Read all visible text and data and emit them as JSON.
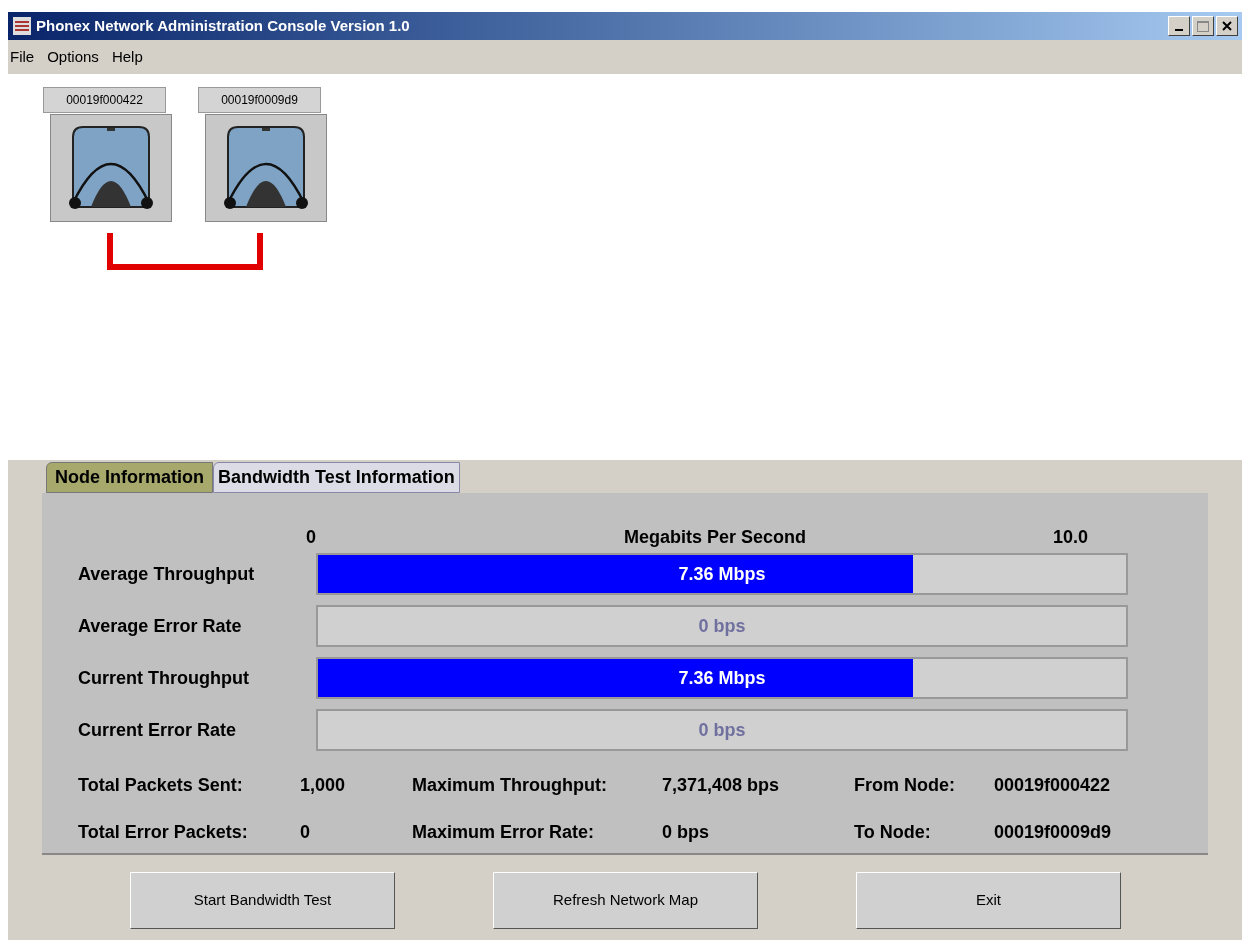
{
  "window": {
    "title": "Phonex Network Administration Console Version 1.0"
  },
  "menu": [
    "File",
    "Options",
    "Help"
  ],
  "nodes": [
    {
      "label": "00019f000422"
    },
    {
      "label": "00019f0009d9"
    }
  ],
  "tabs": [
    {
      "label": "Node Information",
      "selected": true
    },
    {
      "label": "Bandwidth Test Information",
      "selected": false
    }
  ],
  "scale": {
    "min": "0",
    "title": "Megabits Per Second",
    "max": "10.0"
  },
  "meters": [
    {
      "label": "Average Throughput",
      "level": 0.736,
      "reading": "7.36 Mbps"
    },
    {
      "label": "Average Error Rate",
      "level": 0,
      "reading": "0 bps"
    },
    {
      "label": "Current Throughput",
      "level": 0.736,
      "reading": "7.36 Mbps"
    },
    {
      "label": "Current Error Rate",
      "level": 0,
      "reading": "0 bps"
    }
  ],
  "stats": [
    [
      {
        "label": "Total Packets Sent:",
        "value": "1,000"
      },
      {
        "label": "Maximum Throughput:",
        "value": "7,371,408 bps"
      },
      {
        "label": "From Node:",
        "value": "00019f000422"
      }
    ],
    [
      {
        "label": "Total Error Packets:",
        "value": "0"
      },
      {
        "label": "Maximum Error Rate:",
        "value": "0 bps"
      },
      {
        "label": "To Node:",
        "value": "00019f0009d9"
      }
    ]
  ],
  "buttons": [
    "Start Bandwidth Test",
    "Refresh Network Map",
    "Exit"
  ]
}
